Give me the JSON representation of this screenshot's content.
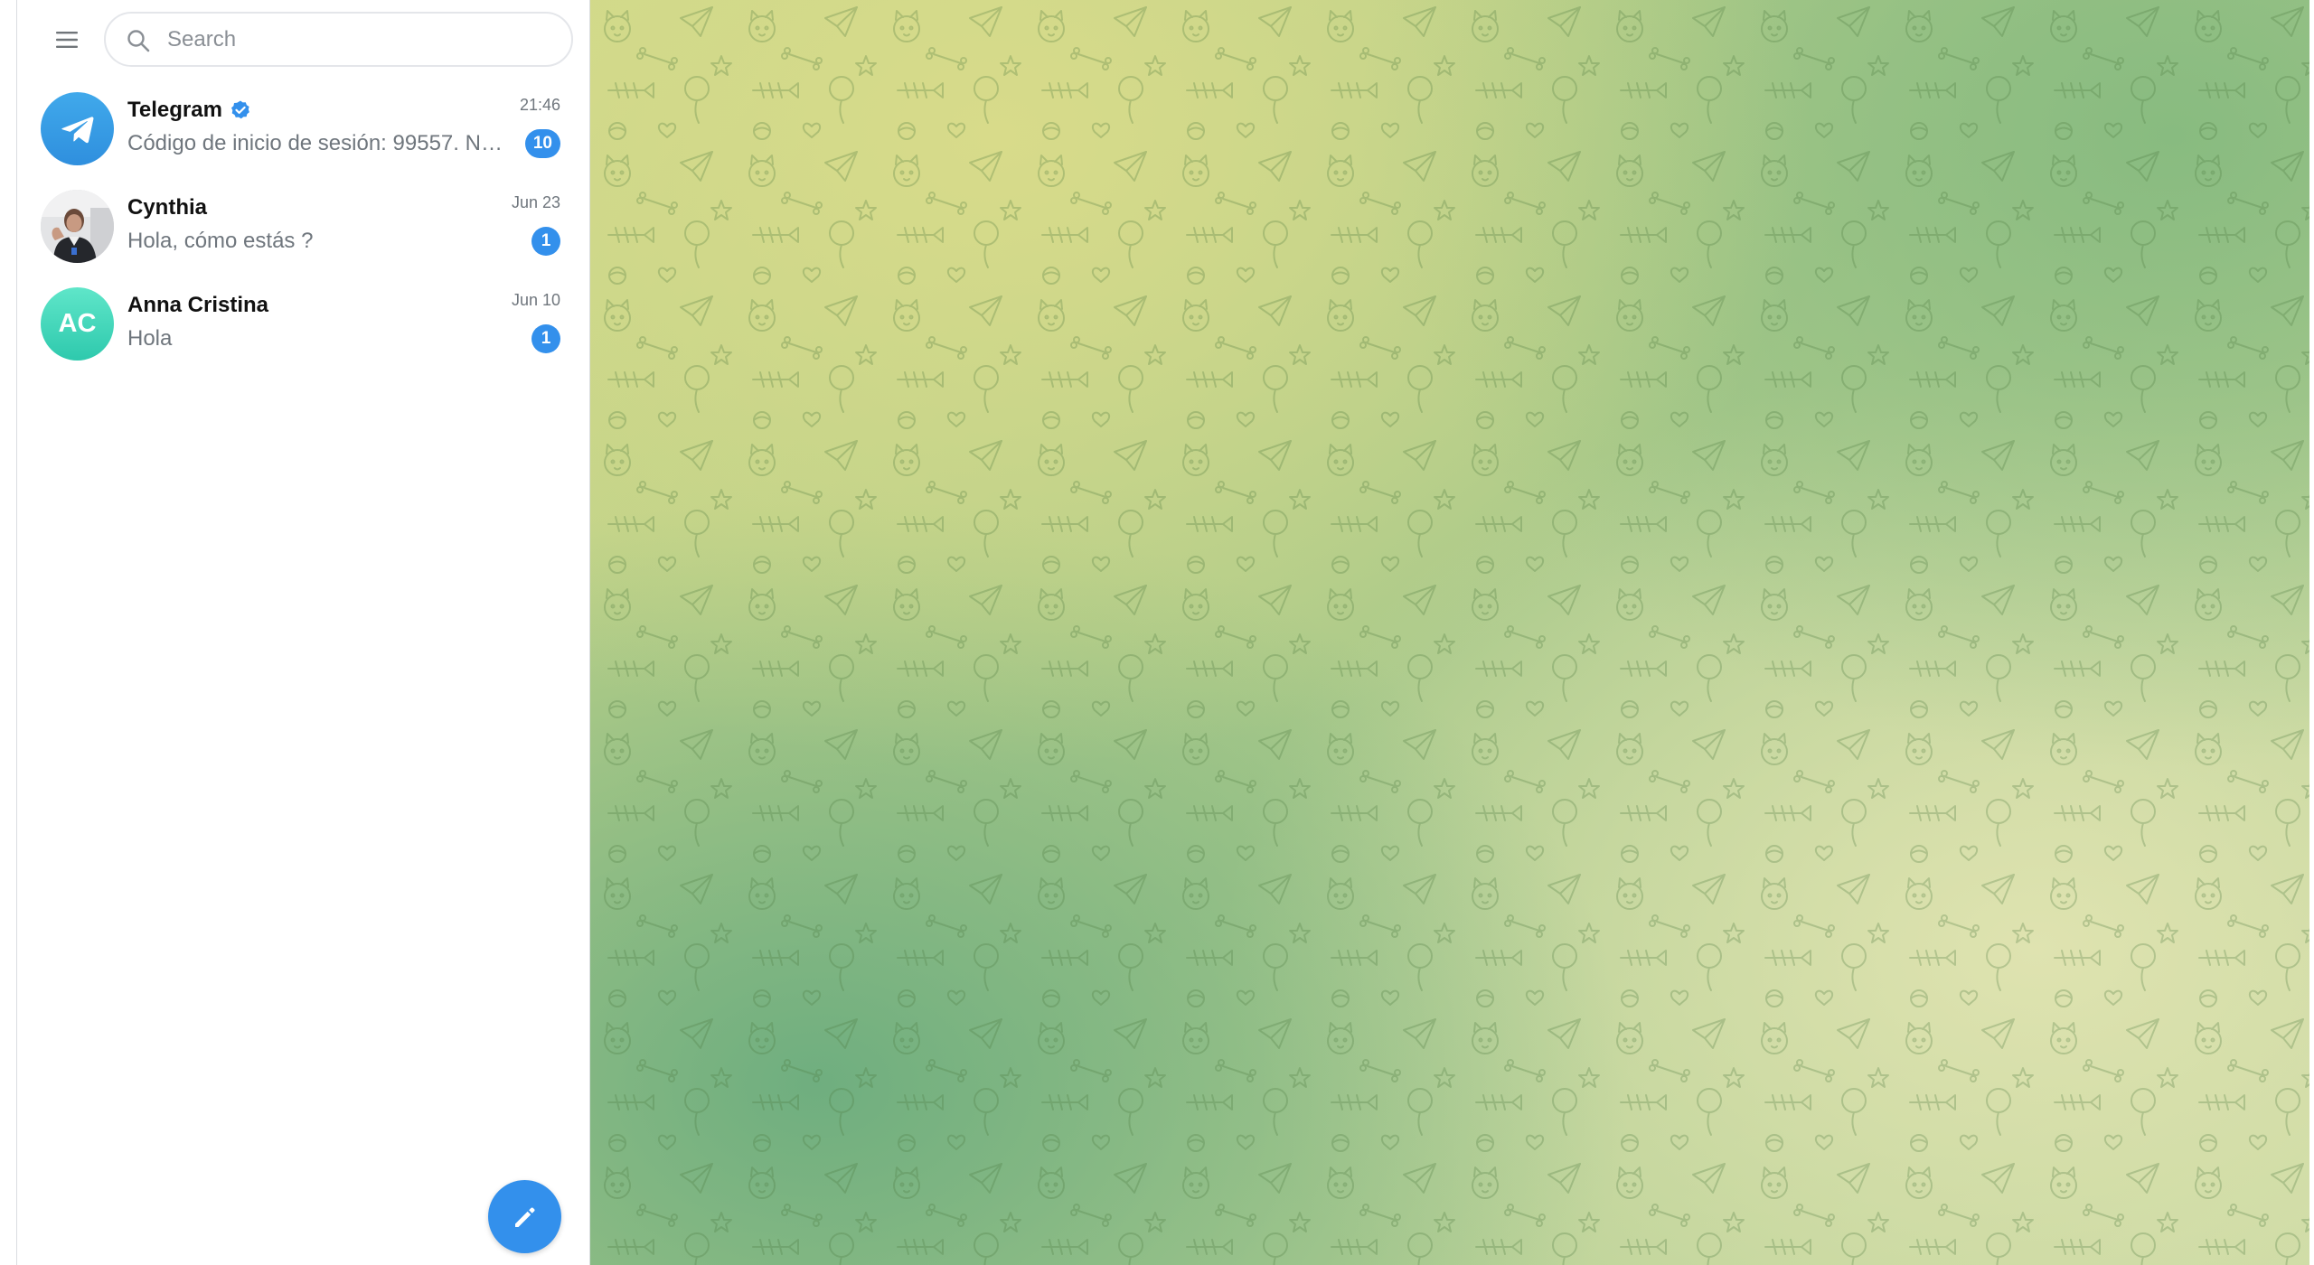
{
  "sidebar": {
    "menu_icon": "hamburger-menu-icon",
    "search": {
      "placeholder": "Search",
      "icon": "search-icon"
    },
    "chats": [
      {
        "name": "Telegram",
        "verified": true,
        "time": "21:46",
        "preview": "Código de inicio de sesión: 99557. No...",
        "unread": "10",
        "avatar": "telegram-logo-icon"
      },
      {
        "name": "Cynthia",
        "verified": false,
        "time": "Jun 23",
        "preview": "Hola, cómo estás ?",
        "unread": "1",
        "avatar": "photo"
      },
      {
        "name": "Anna Cristina",
        "verified": false,
        "time": "Jun 10",
        "preview": "Hola",
        "unread": "1",
        "avatar_initials": "AC"
      }
    ],
    "compose_icon": "pencil-icon"
  },
  "colors": {
    "accent": "#3390ec",
    "badge": "#3390ec",
    "ac_avatar": "#2ec9ad",
    "wallpaper_main": "#a9c98a"
  }
}
